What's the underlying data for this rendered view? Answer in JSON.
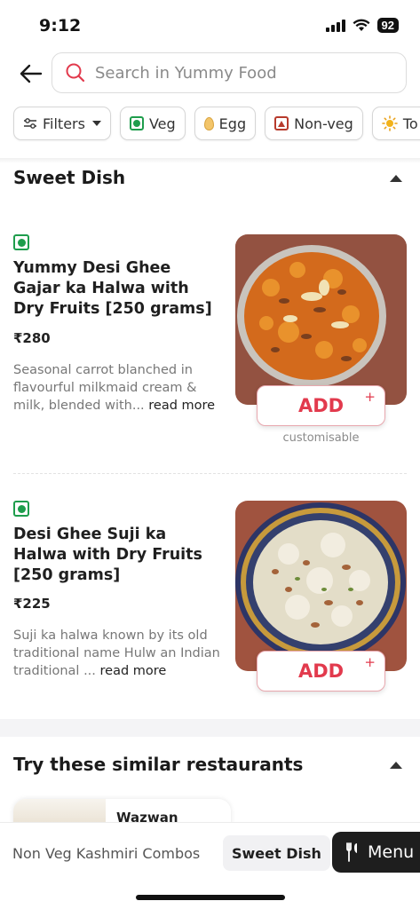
{
  "status": {
    "time": "9:12",
    "battery": "92"
  },
  "search": {
    "placeholder": "Search in Yummy Food"
  },
  "filters": [
    {
      "label": "Filters",
      "icon": "sliders-icon"
    },
    {
      "label": "Veg",
      "icon": "veg-icon"
    },
    {
      "label": "Egg",
      "icon": "egg-icon"
    },
    {
      "label": "Non-veg",
      "icon": "non-veg-icon"
    },
    {
      "label": "To",
      "icon": "sun-icon"
    }
  ],
  "section": {
    "title": "Sweet Dish"
  },
  "items": [
    {
      "name": "Yummy Desi Ghee Gajar ka Halwa with Dry Fruits [250 grams]",
      "price": "₹280",
      "description": "Seasonal carrot blanched in flavourful milkmaid cream & milk, blended with...",
      "read_more": "read more",
      "add_label": "ADD",
      "plus": "+",
      "customisable": "customisable"
    },
    {
      "name": "Desi Ghee Suji ka Halwa with Dry Fruits [250 grams]",
      "price": "₹225",
      "description": "Suji ka halwa known by its old traditional name Hulw an Indian traditional ...",
      "read_more": "read more",
      "add_label": "ADD",
      "plus": "+"
    }
  ],
  "similar": {
    "title": "Try these similar restaurants",
    "restaurant_name": "Wazwan"
  },
  "bottom_nav": {
    "tabs": [
      "Non Veg Kashmiri Combos",
      "Sweet Dish"
    ],
    "menu_label": "Menu"
  },
  "colors": {
    "accent": "#e23a4d",
    "veg": "#1e9d4c",
    "nonveg": "#b73a2c"
  }
}
